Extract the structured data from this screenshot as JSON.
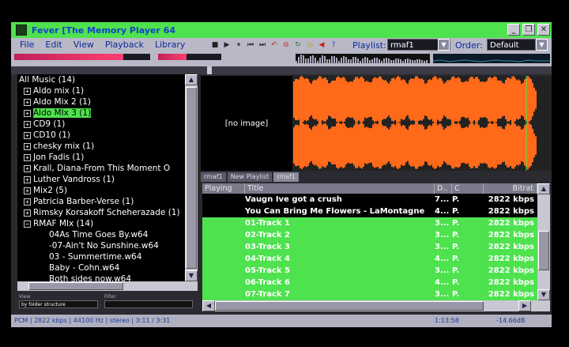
{
  "window": {
    "title": "Fever   [The Memory Player 64",
    "buttons": [
      "_",
      "❐",
      "✕"
    ]
  },
  "menu": [
    "File",
    "Edit",
    "View",
    "Playback",
    "Library"
  ],
  "transport": [
    "■",
    "▶",
    "⏸",
    "⏮",
    "⏭",
    "↶",
    "⊖",
    "↻",
    "◎",
    "◀",
    "?"
  ],
  "playlist": {
    "label": "Playlist:",
    "value": "rmaf1"
  },
  "order": {
    "label": "Order:",
    "value": "Default"
  },
  "volume_level": 0.8,
  "balance_level": 0.45,
  "tree": {
    "items": [
      {
        "label": "All Music (14)",
        "level": 0,
        "expander": false
      },
      {
        "label": "Aldo mix (1)",
        "level": 1,
        "expander": true
      },
      {
        "label": "Aldo Mix 2 (1)",
        "level": 1,
        "expander": true
      },
      {
        "label": "Aldo MIx 3 (1)",
        "level": 1,
        "expander": true,
        "selected": true
      },
      {
        "label": "CD9 (1)",
        "level": 1,
        "expander": true
      },
      {
        "label": "CD10 (1)",
        "level": 1,
        "expander": true
      },
      {
        "label": "chesky mix (1)",
        "level": 1,
        "expander": true
      },
      {
        "label": "Jon Fadis (1)",
        "level": 1,
        "expander": true
      },
      {
        "label": "Krall, Diana-From This Moment O",
        "level": 1,
        "expander": true
      },
      {
        "label": "Luther Vandross (1)",
        "level": 1,
        "expander": true
      },
      {
        "label": "Mix2 (5)",
        "level": 1,
        "expander": true
      },
      {
        "label": "Patricia Barber-Verse (1)",
        "level": 1,
        "expander": true
      },
      {
        "label": "Rimsky Korsakoff  Scheherazade (1)",
        "level": 1,
        "expander": true
      },
      {
        "label": "RMAF MIx (14)",
        "level": 1,
        "expander": true,
        "expanded": true
      },
      {
        "label": "04As Time Goes By.w64",
        "level": 2,
        "expander": false
      },
      {
        "label": "-07-Ain't No Sunshine.w64",
        "level": 2,
        "expander": false
      },
      {
        "label": " 03 - Summertime.w64",
        "level": 2,
        "expander": false
      },
      {
        "label": "Baby  - Cohn.w64",
        "level": 2,
        "expander": false
      },
      {
        "label": "Both sides now.w64",
        "level": 2,
        "expander": false
      }
    ]
  },
  "view": {
    "label": "View",
    "value": "by folder structure",
    "filter_label": "Filter",
    "filter_value": ""
  },
  "cover": {
    "text": "[no image]"
  },
  "tabs": [
    "rmaf1",
    "New Playlist",
    "rmaf1"
  ],
  "columns": {
    "playing": "Playing",
    "title": "Title",
    "d": "D..",
    "c": "C",
    "bitrate": "Bitrat"
  },
  "tracks": [
    {
      "title": "Vaugn Ive got a crush",
      "d": "7...",
      "c": "P.",
      "bitrate": "2822 kbps",
      "green": false
    },
    {
      "title": "You Can Bring Me Flowers - LaMontagne",
      "d": "4...",
      "c": "P.",
      "bitrate": "2822 kbps",
      "green": false
    },
    {
      "title": "01-Track 1",
      "d": "3...",
      "c": "P.",
      "bitrate": "2822 kbps",
      "green": true
    },
    {
      "title": "02-Track 2",
      "d": "3...",
      "c": "P.",
      "bitrate": "2822 kbps",
      "green": true
    },
    {
      "title": "03-Track 3",
      "d": "3...",
      "c": "P.",
      "bitrate": "2822 kbps",
      "green": true
    },
    {
      "title": "04-Track 4",
      "d": "4...",
      "c": "P.",
      "bitrate": "2822 kbps",
      "green": true
    },
    {
      "title": "05-Track 5",
      "d": "3...",
      "c": "P.",
      "bitrate": "2822 kbps",
      "green": true
    },
    {
      "title": "06-Track 6",
      "d": "4...",
      "c": "P.",
      "bitrate": "2822 kbps",
      "green": true
    },
    {
      "title": "07-Track 7",
      "d": "3...",
      "c": "P.",
      "bitrate": "2822 kbps",
      "green": true
    }
  ],
  "status": {
    "info": "PCM | 2822 kbps | 44100 Hz | stereo | 3:11 / 3:31",
    "time": "1:13:58",
    "level": "-14.66dB"
  },
  "colors": {
    "title_bar": "#4ee24e",
    "title_text": "#1840c8",
    "waveform": "#ff6a1a",
    "selection": "#4ee24e"
  }
}
